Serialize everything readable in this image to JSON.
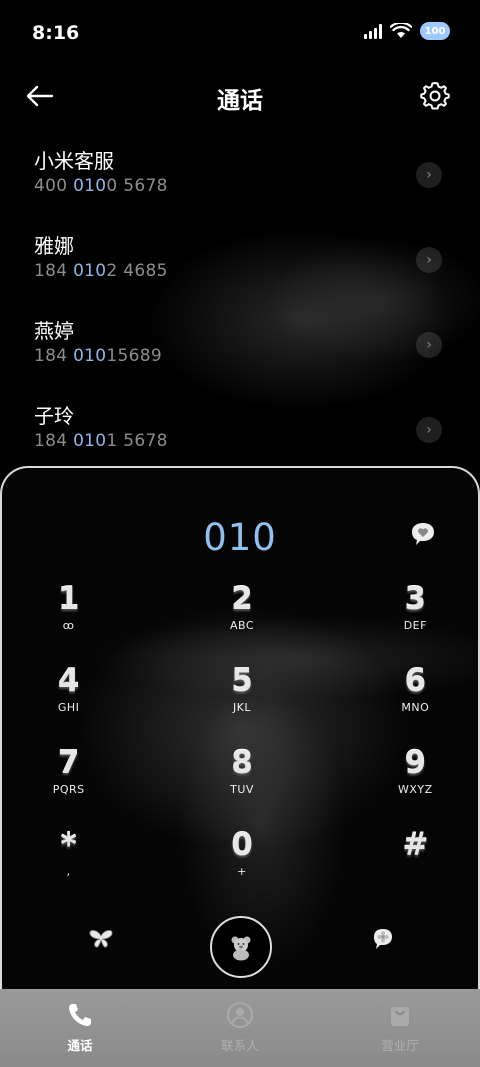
{
  "status_bar": {
    "time": "8:16",
    "battery": "100"
  },
  "header": {
    "title": "通话"
  },
  "recent_calls": [
    {
      "name": "小米客服",
      "number_pre": "400 ",
      "number_match": "010",
      "number_post": "0 5678"
    },
    {
      "name": "雅娜",
      "number_pre": "184 ",
      "number_match": "010",
      "number_post": "2 4685"
    },
    {
      "name": "燕婷",
      "number_pre": "184 ",
      "number_match": "010",
      "number_post": "15689"
    },
    {
      "name": "子玲",
      "number_pre": "184 ",
      "number_match": "010",
      "number_post": "1 5678"
    }
  ],
  "dialpad": {
    "entry": "010",
    "keys": [
      [
        {
          "digit": "1",
          "letters": "ꝏ"
        },
        {
          "digit": "2",
          "letters": "ABC"
        },
        {
          "digit": "3",
          "letters": "DEF"
        }
      ],
      [
        {
          "digit": "4",
          "letters": "GHI"
        },
        {
          "digit": "5",
          "letters": "JKL"
        },
        {
          "digit": "6",
          "letters": "MNO"
        }
      ],
      [
        {
          "digit": "7",
          "letters": "PQRS"
        },
        {
          "digit": "8",
          "letters": "TUV"
        },
        {
          "digit": "9",
          "letters": "WXYZ"
        }
      ],
      [
        {
          "digit": "*",
          "letters": ","
        },
        {
          "digit": "0",
          "letters": "+"
        },
        {
          "digit": "#",
          "letters": ""
        }
      ]
    ]
  },
  "tabs": [
    {
      "label": "通话",
      "icon": "phone-icon",
      "active": true
    },
    {
      "label": "联系人",
      "icon": "person-icon",
      "active": false
    },
    {
      "label": "营业厅",
      "icon": "bag-icon",
      "active": false
    }
  ],
  "colors": {
    "accent": "#8fc0ee",
    "highlight": "#8fb6e6",
    "tabbar": "#9a9a9a"
  }
}
